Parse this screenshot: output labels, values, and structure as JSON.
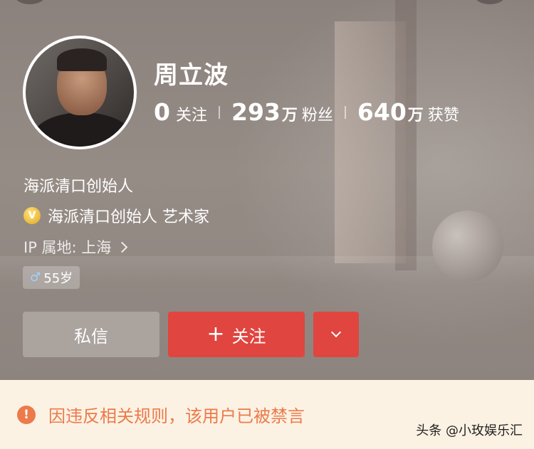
{
  "profile": {
    "name": "周立波",
    "stats": [
      {
        "value": "0",
        "unit": "",
        "label": "关注"
      },
      {
        "value": "293",
        "unit": "万",
        "label": "粉丝"
      },
      {
        "value": "640",
        "unit": "万",
        "label": "获赞"
      }
    ],
    "bio": "海派清口创始人",
    "verification": {
      "badge": "V",
      "text": "海派清口创始人 艺术家"
    },
    "ip_location": "IP 属地: 上海",
    "age": "55岁",
    "gender_icon": "male-icon"
  },
  "actions": {
    "message_label": "私信",
    "follow_plus": "+",
    "follow_label": "关注"
  },
  "notice": {
    "icon": "!",
    "text": "因违反相关规则，该用户已被禁言"
  },
  "watermark": "头条 @小玫娱乐汇",
  "colors": {
    "accent_red": "#e0453f",
    "notice_bg": "#fcf2e4",
    "notice_text": "#ec7a4a",
    "badge_gold": "#e0a722"
  }
}
